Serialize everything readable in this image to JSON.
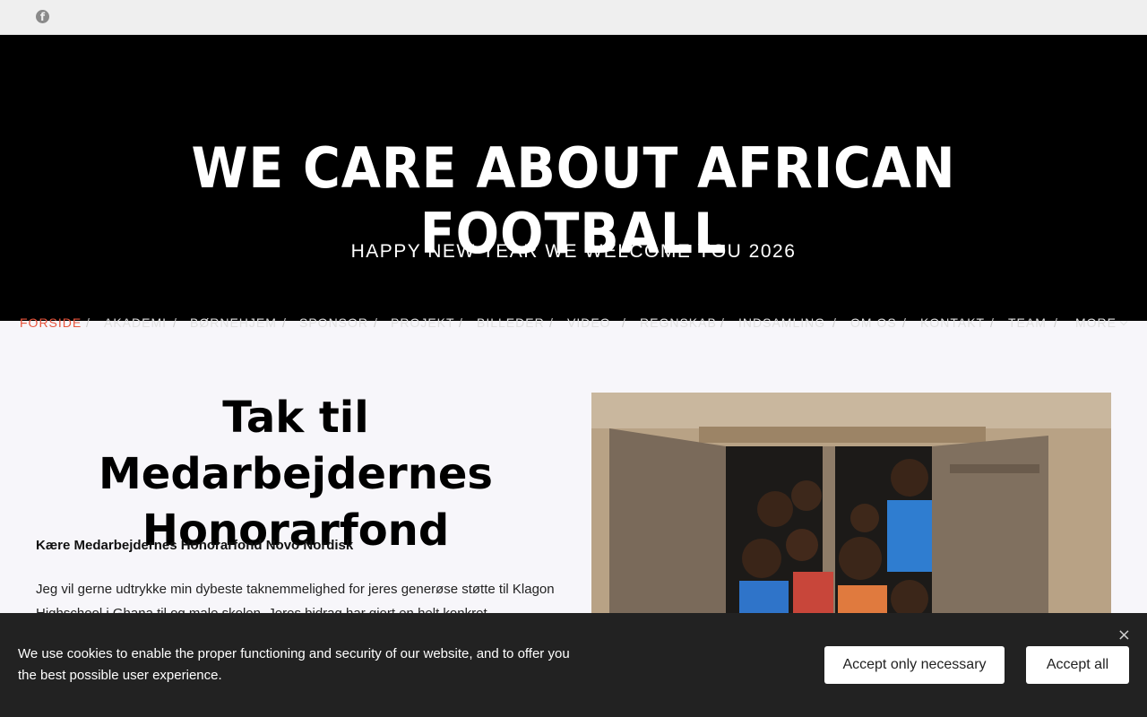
{
  "topbar": {
    "facebook_icon": "facebook-icon"
  },
  "header": {
    "title": "WE CARE ABOUT AFRICAN FOOTBALL",
    "subtitle": "HAPPY NEW YEAR WE WELCOME YOU 2026"
  },
  "nav": {
    "items": [
      "FORSIDE",
      "AKADEMI",
      "BØRNEHJEM",
      "SPONSOR",
      "PROJEKT",
      "BILLEDER",
      "VIDEO",
      "REGNSKAB",
      "INDSAMLING",
      "OM OS",
      "KONTAKT",
      "TEAM",
      "MORE"
    ],
    "separator": "/",
    "active": "FORSIDE",
    "active_color": "#e8553d"
  },
  "main": {
    "title": "Tak til Medarbejdernes Honorarfond",
    "greeting": "Kære Medarbejdernes Honorarfond Novo Nordisk",
    "paragraph": "Jeg vil gerne udtrykke min dybeste taknemmelighed for jeres generøse støtte til Klagon Highschool i Ghana til og male skolen. Jeres bidrag har gjort en helt konkret"
  },
  "cookie": {
    "text": "We use cookies to enable the proper functioning and security of our website, and to offer you the best possible user experience.",
    "accept_necessary": "Accept only necessary",
    "accept_all": "Accept all",
    "close": "×"
  }
}
